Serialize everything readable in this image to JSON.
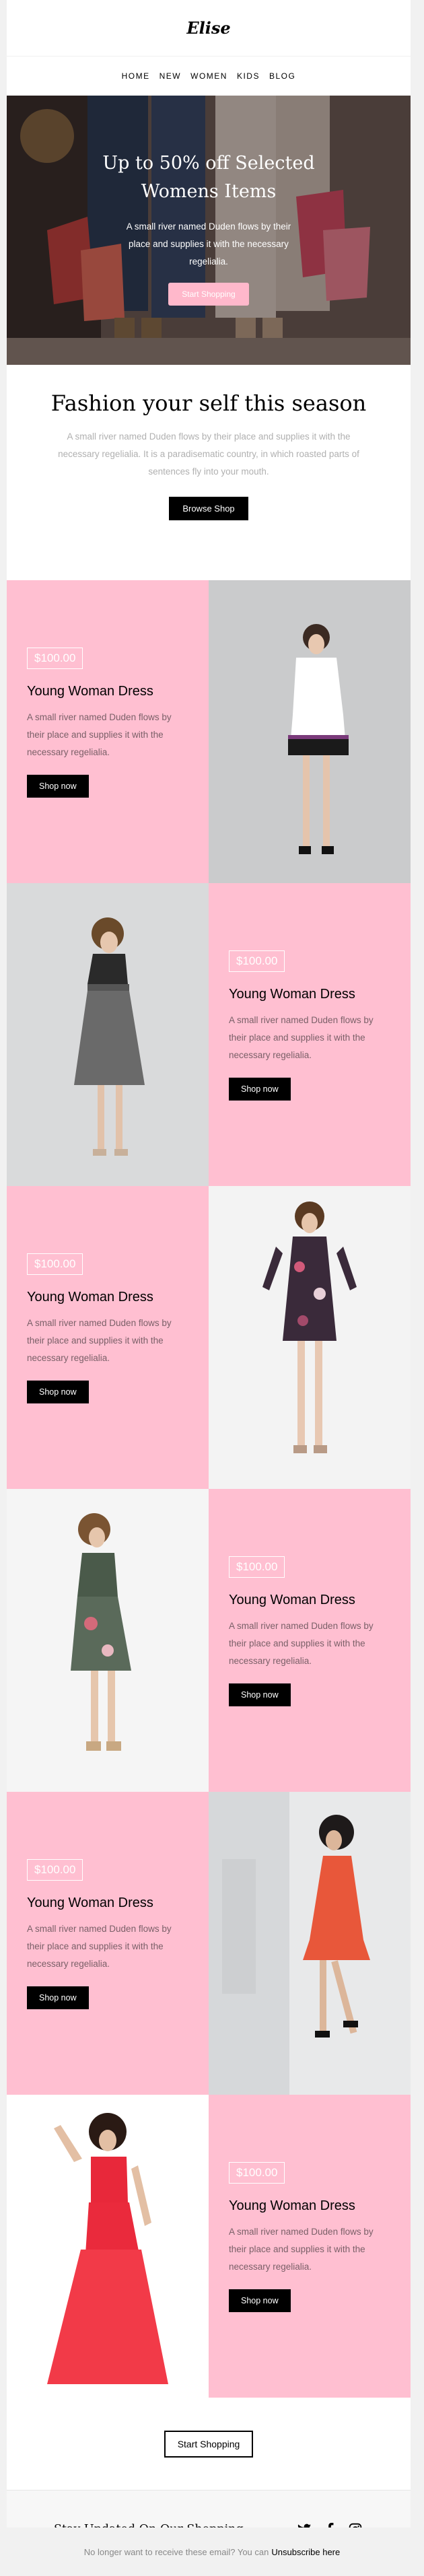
{
  "brand": {
    "logo": "Elise"
  },
  "nav": {
    "items": [
      "HOME",
      "NEW",
      "WOMEN",
      "KIDS",
      "BLOG"
    ]
  },
  "hero": {
    "title": "Up to 50% off Selected Womens Items",
    "text": "A small river named Duden flows by their place and supplies it with the necessary regelialia.",
    "button": "Start Shopping"
  },
  "intro": {
    "title": "Fashion your self this season",
    "text": "A small river named Duden flows by their place and supplies it with the necessary regelialia. It is a paradisematic country, in which roasted parts of sentences fly into your mouth.",
    "button": "Browse Shop"
  },
  "products": [
    {
      "price": "$100.00",
      "title": "Young Woman Dress",
      "desc": "A small river named Duden flows by their place and supplies it with the necessary regelialia.",
      "button": "Shop now"
    },
    {
      "price": "$100.00",
      "title": "Young Woman Dress",
      "desc": "A small river named Duden flows by their place and supplies it with the necessary regelialia.",
      "button": "Shop now"
    },
    {
      "price": "$100.00",
      "title": "Young Woman Dress",
      "desc": "A small river named Duden flows by their place and supplies it with the necessary regelialia.",
      "button": "Shop now"
    },
    {
      "price": "$100.00",
      "title": "Young Woman Dress",
      "desc": "A small river named Duden flows by their place and supplies it with the necessary regelialia.",
      "button": "Shop now"
    },
    {
      "price": "$100.00",
      "title": "Young Woman Dress",
      "desc": "A small river named Duden flows by their place and supplies it with the necessary regelialia.",
      "button": "Shop now"
    },
    {
      "price": "$100.00",
      "title": "Young Woman Dress",
      "desc": "A small river named Duden flows by their place and supplies it with the necessary regelialia.",
      "button": "Shop now"
    }
  ],
  "bottom": {
    "button": "Start Shopping"
  },
  "footer": {
    "stay": "Stay Updated On Our Shopping",
    "social": [
      "twitter-icon",
      "facebook-icon",
      "instagram-icon"
    ]
  },
  "unsubscribe": {
    "text": "No longer want to receive these email? You can",
    "link": "Unsubscribe here"
  },
  "colors": {
    "pink": "#ffbfd1",
    "button_pink": "#ffb8cb",
    "black": "#000000"
  }
}
